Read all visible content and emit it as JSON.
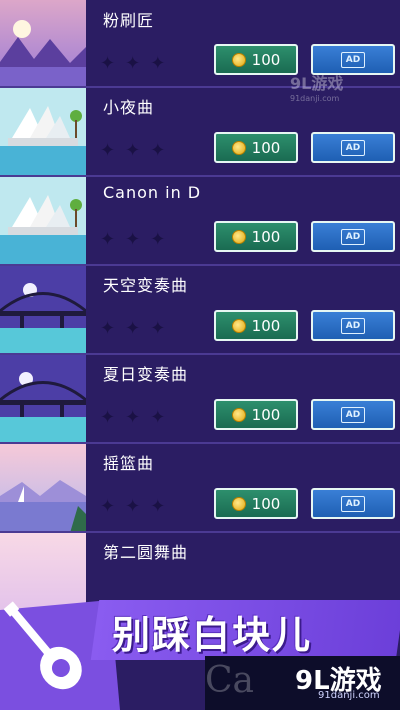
{
  "songs": [
    {
      "title": "粉刷匠",
      "price": "100",
      "ad": "AD",
      "thumb": "sunset-sea"
    },
    {
      "title": "小夜曲",
      "price": "100",
      "ad": "AD",
      "thumb": "opera-house"
    },
    {
      "title": "Canon in D",
      "price": "100",
      "ad": "AD",
      "thumb": "opera-house"
    },
    {
      "title": "天空变奏曲",
      "price": "100",
      "ad": "AD",
      "thumb": "night-bridge"
    },
    {
      "title": "夏日变奏曲",
      "price": "100",
      "ad": "AD",
      "thumb": "night-bridge"
    },
    {
      "title": "摇篮曲",
      "price": "100",
      "ad": "AD",
      "thumb": "sailboat-lake"
    },
    {
      "title": "第二圆舞曲",
      "thumb": "pink-sky"
    }
  ],
  "watermark": {
    "brand": "9L游戏",
    "site": "91danji.com"
  },
  "promo": {
    "text": "别踩白块儿"
  },
  "footer": {
    "logo": "9L游戏",
    "site": "91danji.com",
    "bg_text": "Ca"
  },
  "colors": {
    "bg": "#2b1d63",
    "coin_btn": "#2d8f6d",
    "ad_btn": "#3a7fd6",
    "promo_band": "#8a5cf0"
  }
}
